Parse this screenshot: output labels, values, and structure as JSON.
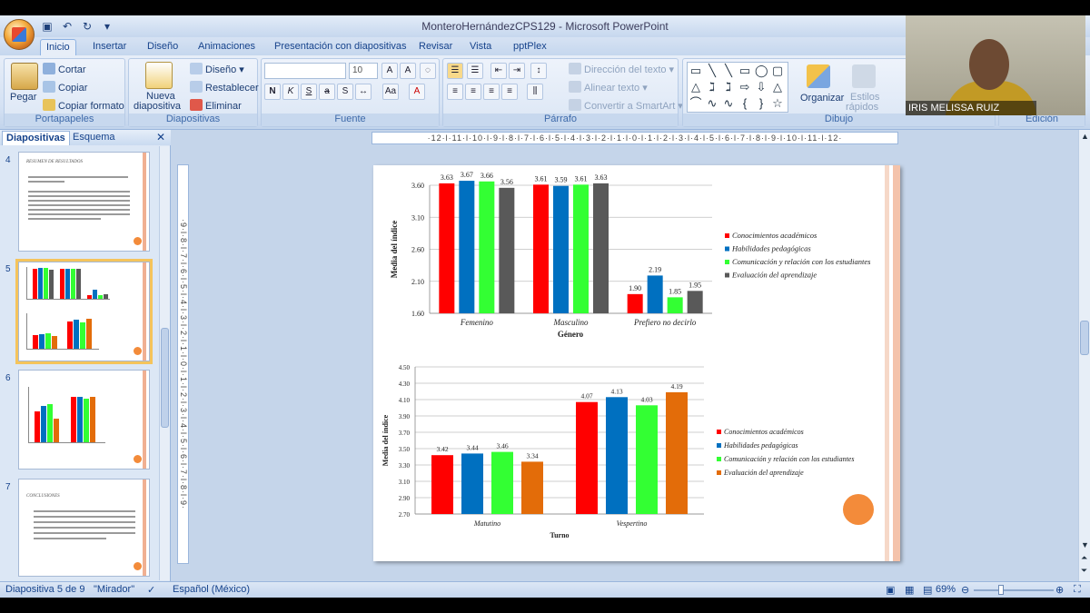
{
  "window": {
    "title": "MonteroHernándezCPS129 - Microsoft PowerPoint"
  },
  "tabs": [
    "Inicio",
    "Insertar",
    "Diseño",
    "Animaciones",
    "Presentación con diapositivas",
    "Revisar",
    "Vista",
    "pptPlex"
  ],
  "ribbon": {
    "portapapeles": {
      "label": "Portapapeles",
      "paste": "Pegar",
      "cut": "Cortar",
      "copy": "Copiar",
      "format_painter": "Copiar formato"
    },
    "diapositivas": {
      "label": "Diapositivas",
      "new_slide_1": "Nueva",
      "new_slide_2": "diapositiva",
      "layout": "Diseño",
      "reset": "Restablecer",
      "delete": "Eliminar"
    },
    "fuente": {
      "label": "Fuente",
      "font_name": "",
      "font_size": "10"
    },
    "parrafo": {
      "label": "Párrafo",
      "text_direction": "Dirección del texto",
      "align_text": "Alinear texto",
      "smartart": "Convertir a SmartArt"
    },
    "dibujo": {
      "label": "Dibujo",
      "arrange": "Organizar",
      "quick_styles_1": "Estilos",
      "quick_styles_2": "rápidos"
    },
    "edicion": {
      "label": "Edición"
    }
  },
  "webcam": {
    "name": "IRIS MELISSA RUIZ ALFARO"
  },
  "left_panel": {
    "tab_slides": "Diapositivas",
    "tab_outline": "Esquema",
    "slides": [
      {
        "number": "4",
        "title": "RESUMEN DE RESULTADOS"
      },
      {
        "number": "5"
      },
      {
        "number": "6"
      },
      {
        "number": "7",
        "title": "CONCLUSIONES"
      }
    ]
  },
  "rulers": {
    "horizontal": "·12·l·11·l·10·l·9·l·8·l·7·l·6·l·5·l·4·l·3·l·2·l·1·l·0·l·1·l·2·l·3·l·4·l·5·l·6·l·7·l·8·l·9·l·10·l·11·l·12·",
    "vertical": "·9·l·8·l·7·l·6·l·5·l·4·l·3·l·2·l·1·l·0·l·1·l·2·l·3·l·4·l·5·l·6·l·7·l·8·l·9·"
  },
  "colors": {
    "red": "#ff0000",
    "blue": "#0070c0",
    "green": "#33ff33",
    "gray": "#595959",
    "orange": "#e36c09"
  },
  "chart_data": [
    {
      "type": "bar",
      "categories": [
        "Femenino",
        "Masculino",
        "Prefiero no decirlo"
      ],
      "series": [
        {
          "name": "Conocimientos académicos",
          "values": [
            3.63,
            3.61,
            1.9
          ]
        },
        {
          "name": "Habilidades pedagógicas",
          "values": [
            3.67,
            3.59,
            2.19
          ]
        },
        {
          "name": "Comunicación y relación con los estudiantes",
          "values": [
            3.66,
            3.61,
            1.85
          ]
        },
        {
          "name": "Evaluación del aprendizaje",
          "values": [
            3.56,
            3.63,
            1.95
          ]
        }
      ],
      "value_labels": [
        [
          "3.63",
          "3.67",
          "3.66",
          "3.56"
        ],
        [
          "3.61",
          "3.59",
          "3.61",
          "3.63"
        ],
        [
          "1.90",
          "2.19",
          "1.85",
          "1.95"
        ]
      ],
      "xlabel": "Género",
      "ylabel": "Media del índice",
      "ylim": [
        1.6,
        3.6
      ],
      "yticks": [
        "3.60",
        "3.10",
        "2.60",
        "2.10",
        "1.60"
      ],
      "legend": "right",
      "grid": true
    },
    {
      "type": "bar",
      "categories": [
        "Matutino",
        "Vespertino"
      ],
      "series": [
        {
          "name": "Conocimientos académicos",
          "values": [
            3.42,
            4.07
          ]
        },
        {
          "name": "Habilidades pedagógicas",
          "values": [
            3.44,
            4.13
          ]
        },
        {
          "name": "Comunicación y relación con los estudiantes",
          "values": [
            3.46,
            4.03
          ]
        },
        {
          "name": "Evaluación del aprendizaje",
          "values": [
            3.34,
            4.19
          ]
        }
      ],
      "value_labels": [
        [
          "3.42",
          "3.44",
          "3.46",
          "3.34"
        ],
        [
          "4.07",
          "4.13",
          "4.03",
          "4.19"
        ]
      ],
      "xlabel": "Turno",
      "ylabel": "Media del índice",
      "ylim": [
        2.7,
        4.5
      ],
      "yticks": [
        "4.50",
        "4.30",
        "4.10",
        "3.90",
        "3.70",
        "3.50",
        "3.30",
        "3.10",
        "2.90",
        "2.70"
      ],
      "legend": "right",
      "grid": true
    }
  ],
  "status": {
    "slide": "Diapositiva 5 de 9",
    "theme": "\"Mirador\"",
    "language": "Español (México)",
    "zoom": "69%",
    "zoom_value": 0.69
  }
}
